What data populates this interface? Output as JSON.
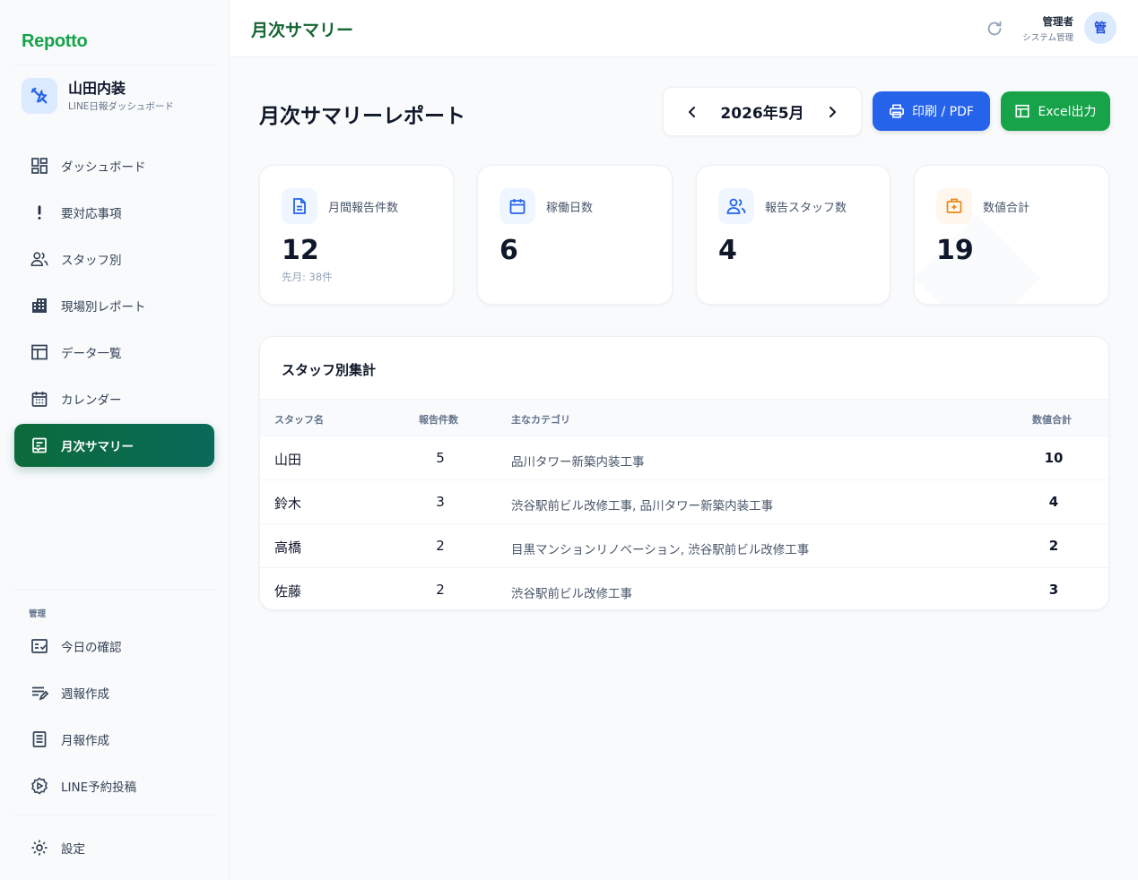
{
  "app": {
    "brand": "Repotto",
    "org_name": "山田内装",
    "org_sub": "LINE日報ダッシュボード"
  },
  "sidebar": {
    "items": [
      {
        "label": "ダッシュボード",
        "icon": "dashboard-grid-icon"
      },
      {
        "label": "要対応事項",
        "icon": "exclamation-icon"
      },
      {
        "label": "スタッフ別",
        "icon": "users-icon"
      },
      {
        "label": "現場別レポート",
        "icon": "building-icon"
      },
      {
        "label": "データ一覧",
        "icon": "table-icon"
      },
      {
        "label": "カレンダー",
        "icon": "calendar-icon"
      },
      {
        "label": "月次サマリー",
        "icon": "report-icon",
        "active": true
      }
    ],
    "admin_section_label": "管理",
    "admin_items": [
      {
        "label": "今日の確認",
        "icon": "checklist-icon"
      },
      {
        "label": "週報作成",
        "icon": "edit-list-icon"
      },
      {
        "label": "月報作成",
        "icon": "document-icon"
      },
      {
        "label": "LINE予約投稿",
        "icon": "scheduled-post-icon"
      }
    ],
    "settings_label": "設定"
  },
  "header": {
    "title": "月次サマリー",
    "user_name": "管理者",
    "user_role": "システム管理",
    "avatar_initial": "管"
  },
  "main": {
    "page_title": "月次サマリーレポート",
    "month": "2026年5月",
    "print_label": "印刷 / PDF",
    "excel_label": "Excel出力"
  },
  "stats": [
    {
      "label": "月間報告件数",
      "value": "12",
      "note": "先月: 38件",
      "icon": "document-icon",
      "color": "#2563eb",
      "bg": "#eff6ff"
    },
    {
      "label": "稼働日数",
      "value": "6",
      "note": "",
      "icon": "calendar-icon",
      "color": "#2563eb",
      "bg": "#eff6ff"
    },
    {
      "label": "報告スタッフ数",
      "value": "4",
      "note": "",
      "icon": "users-icon",
      "color": "#2563eb",
      "bg": "#eff6ff"
    },
    {
      "label": "数値合計",
      "value": "19",
      "note": "",
      "icon": "medical-box-icon",
      "color": "#ea8a1e",
      "bg": "#fff7ed"
    }
  ],
  "staff_table": {
    "title": "スタッフ別集計",
    "columns": [
      "スタッフ名",
      "報告件数",
      "主なカテゴリ",
      "数値合計"
    ],
    "rows": [
      {
        "name": "山田",
        "count": "5",
        "category": "品川タワー新築内装工事",
        "total": "10"
      },
      {
        "name": "鈴木",
        "count": "3",
        "category": "渋谷駅前ビル改修工事, 品川タワー新築内装工事",
        "total": "4"
      },
      {
        "name": "高橋",
        "count": "2",
        "category": "目黒マンションリノベーション, 渋谷駅前ビル改修工事",
        "total": "2"
      },
      {
        "name": "佐藤",
        "count": "2",
        "category": "渋谷駅前ビル改修工事",
        "total": "3"
      }
    ]
  },
  "colors": {
    "brand_green": "#16a34a",
    "active_nav": "#0b6b3a",
    "print_blue": "#2563eb",
    "excel_green": "#16a34a"
  }
}
